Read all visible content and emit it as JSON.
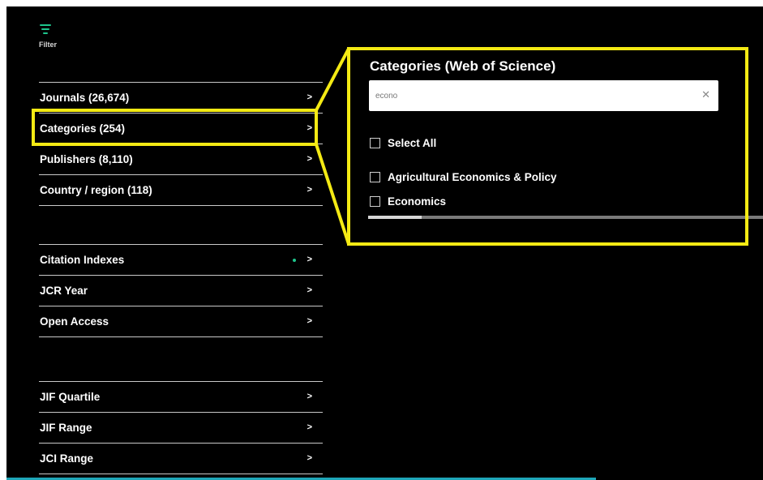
{
  "filter": {
    "icon": "filter-icon",
    "label": "Filter",
    "accent_color": "#1ec58c"
  },
  "groups": [
    {
      "items": [
        {
          "label": "Journals (26,674)"
        },
        {
          "label": "Categories (254)"
        },
        {
          "label": "Publishers (8,110)"
        },
        {
          "label": "Country / region (118)"
        }
      ]
    },
    {
      "items": [
        {
          "label": "Citation Indexes",
          "indicator": true
        },
        {
          "label": "JCR Year"
        },
        {
          "label": "Open Access"
        }
      ]
    },
    {
      "items": [
        {
          "label": "JIF Quartile"
        },
        {
          "label": "JIF Range"
        },
        {
          "label": "JCI Range"
        }
      ]
    }
  ],
  "categories_panel": {
    "title": "Categories (Web of Science)",
    "search_value": "econo",
    "clear_icon": "close-icon",
    "select_all_label": "Select All",
    "options": [
      {
        "label": "Agricultural Economics & Policy",
        "checked": false
      },
      {
        "label": "Economics",
        "checked": false
      }
    ]
  },
  "highlight_color": "#f4ea14",
  "chevron_glyph": ">"
}
